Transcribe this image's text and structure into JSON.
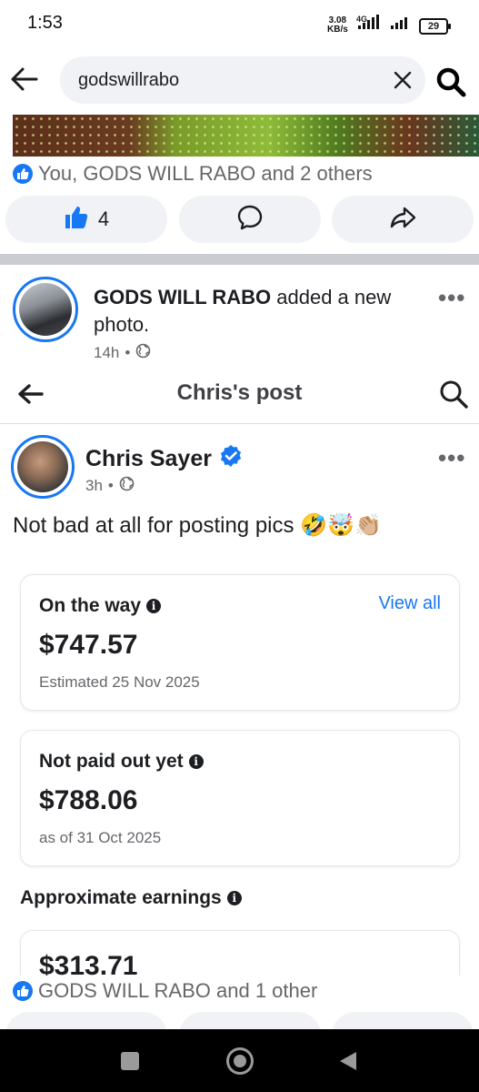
{
  "status_bar": {
    "time": "1:53",
    "net_speed": "3.08",
    "net_unit": "KB/s",
    "net_type": "4G",
    "battery": "29"
  },
  "search": {
    "query": "godswillrabo"
  },
  "first_post": {
    "reactions_text": "You, GODS WILL RABO and 2 others",
    "like_count": "4"
  },
  "post": {
    "author": "GODS WILL RABO",
    "action": " added a new photo.",
    "time": "14h",
    "embedded": {
      "header_title": "Chris's post",
      "author": "Chris Sayer",
      "time": "3h",
      "text": "Not bad at all for posting pics",
      "emojis": "🤣🤯👏🏼",
      "cards": [
        {
          "label": "On the way",
          "link": "View all",
          "amount": "$747.57",
          "sub": "Estimated 25 Nov 2025"
        },
        {
          "label": "Not paid out yet",
          "amount": "$788.06",
          "sub": "as of 31 Oct 2025"
        }
      ],
      "section_label": "Approximate earnings",
      "partial_amount": "$313.71"
    },
    "reactions_text": "GODS WILL RABO and 1 other"
  },
  "colors": {
    "accent": "#1877f2",
    "pill_bg": "#f0f2f5",
    "muted_text": "#65676b"
  }
}
